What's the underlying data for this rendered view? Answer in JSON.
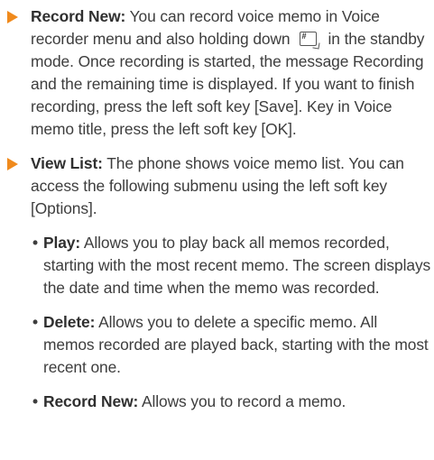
{
  "items": [
    {
      "term": "Record New:",
      "text_before_icon": " You can record voice memo in Voice recorder menu and also holding down",
      "icon": "hash-memo-key-icon",
      "text_after_icon": "in the standby mode. Once recording is started, the message Recording and the remaining time is displayed. If you want to finish recording, press the left soft key [Save]. Key in Voice memo title, press the left soft key [OK]."
    },
    {
      "term": "View List:",
      "text": " The phone shows voice memo list. You can access the following submenu using the left soft key [Options].",
      "subitems": [
        {
          "bullet": "•",
          "term": "Play:",
          "text": " Allows you to play back all memos recorded, starting with the most recent memo. The screen displays the date and time when the memo was recorded."
        },
        {
          "bullet": "•",
          "term": "Delete:",
          "text": " Allows you to delete a specific memo. All memos recorded are played back, starting with the most recent one."
        },
        {
          "bullet": "•",
          "term": "Record New:",
          "text": " Allows you to record a memo."
        }
      ]
    }
  ],
  "colors": {
    "arrow": "#f08a1c",
    "text": "#3d3d3d"
  }
}
